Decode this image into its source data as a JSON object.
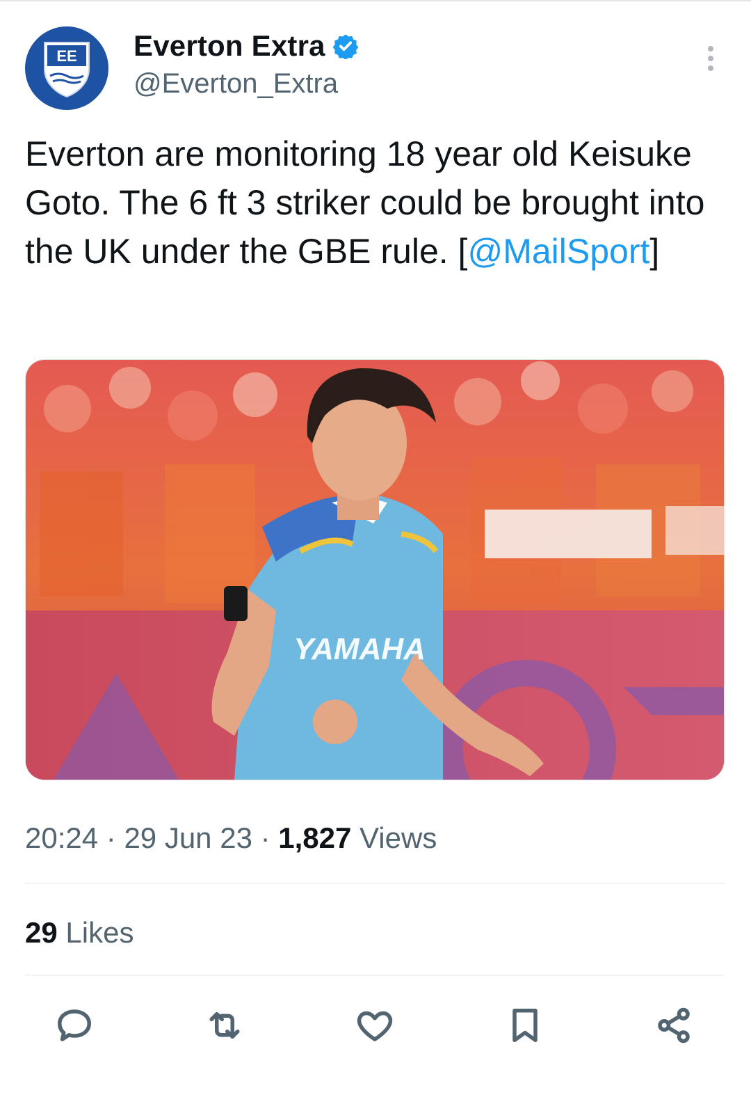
{
  "tweet": {
    "avatar_initials": "EE",
    "display_name": "Everton Extra",
    "handle": "@Everton_Extra",
    "text_main": "Everton are monitoring 18 year old Keisuke Goto. The 6 ft 3 striker could be brought into the UK under the GBE rule. [",
    "mention": "@MailSport",
    "text_end": "]",
    "media_caption_text": "YAMAHA",
    "time": "20:24",
    "date": "29 Jun 23",
    "views_count": "1,827",
    "views_label": "Views",
    "likes_count": "29",
    "likes_label": "Likes"
  },
  "actions": [
    {
      "name": "reply",
      "icon": "chat-bubble-icon"
    },
    {
      "name": "retweet",
      "icon": "retweet-icon"
    },
    {
      "name": "like",
      "icon": "heart-icon"
    },
    {
      "name": "bookmark",
      "icon": "bookmark-icon"
    },
    {
      "name": "share",
      "icon": "share-icon"
    }
  ],
  "colors": {
    "link": "#1d9bf0",
    "secondary_text": "#536471",
    "verified": "#1d9bf0",
    "avatar_bg": "#1e52a3"
  }
}
